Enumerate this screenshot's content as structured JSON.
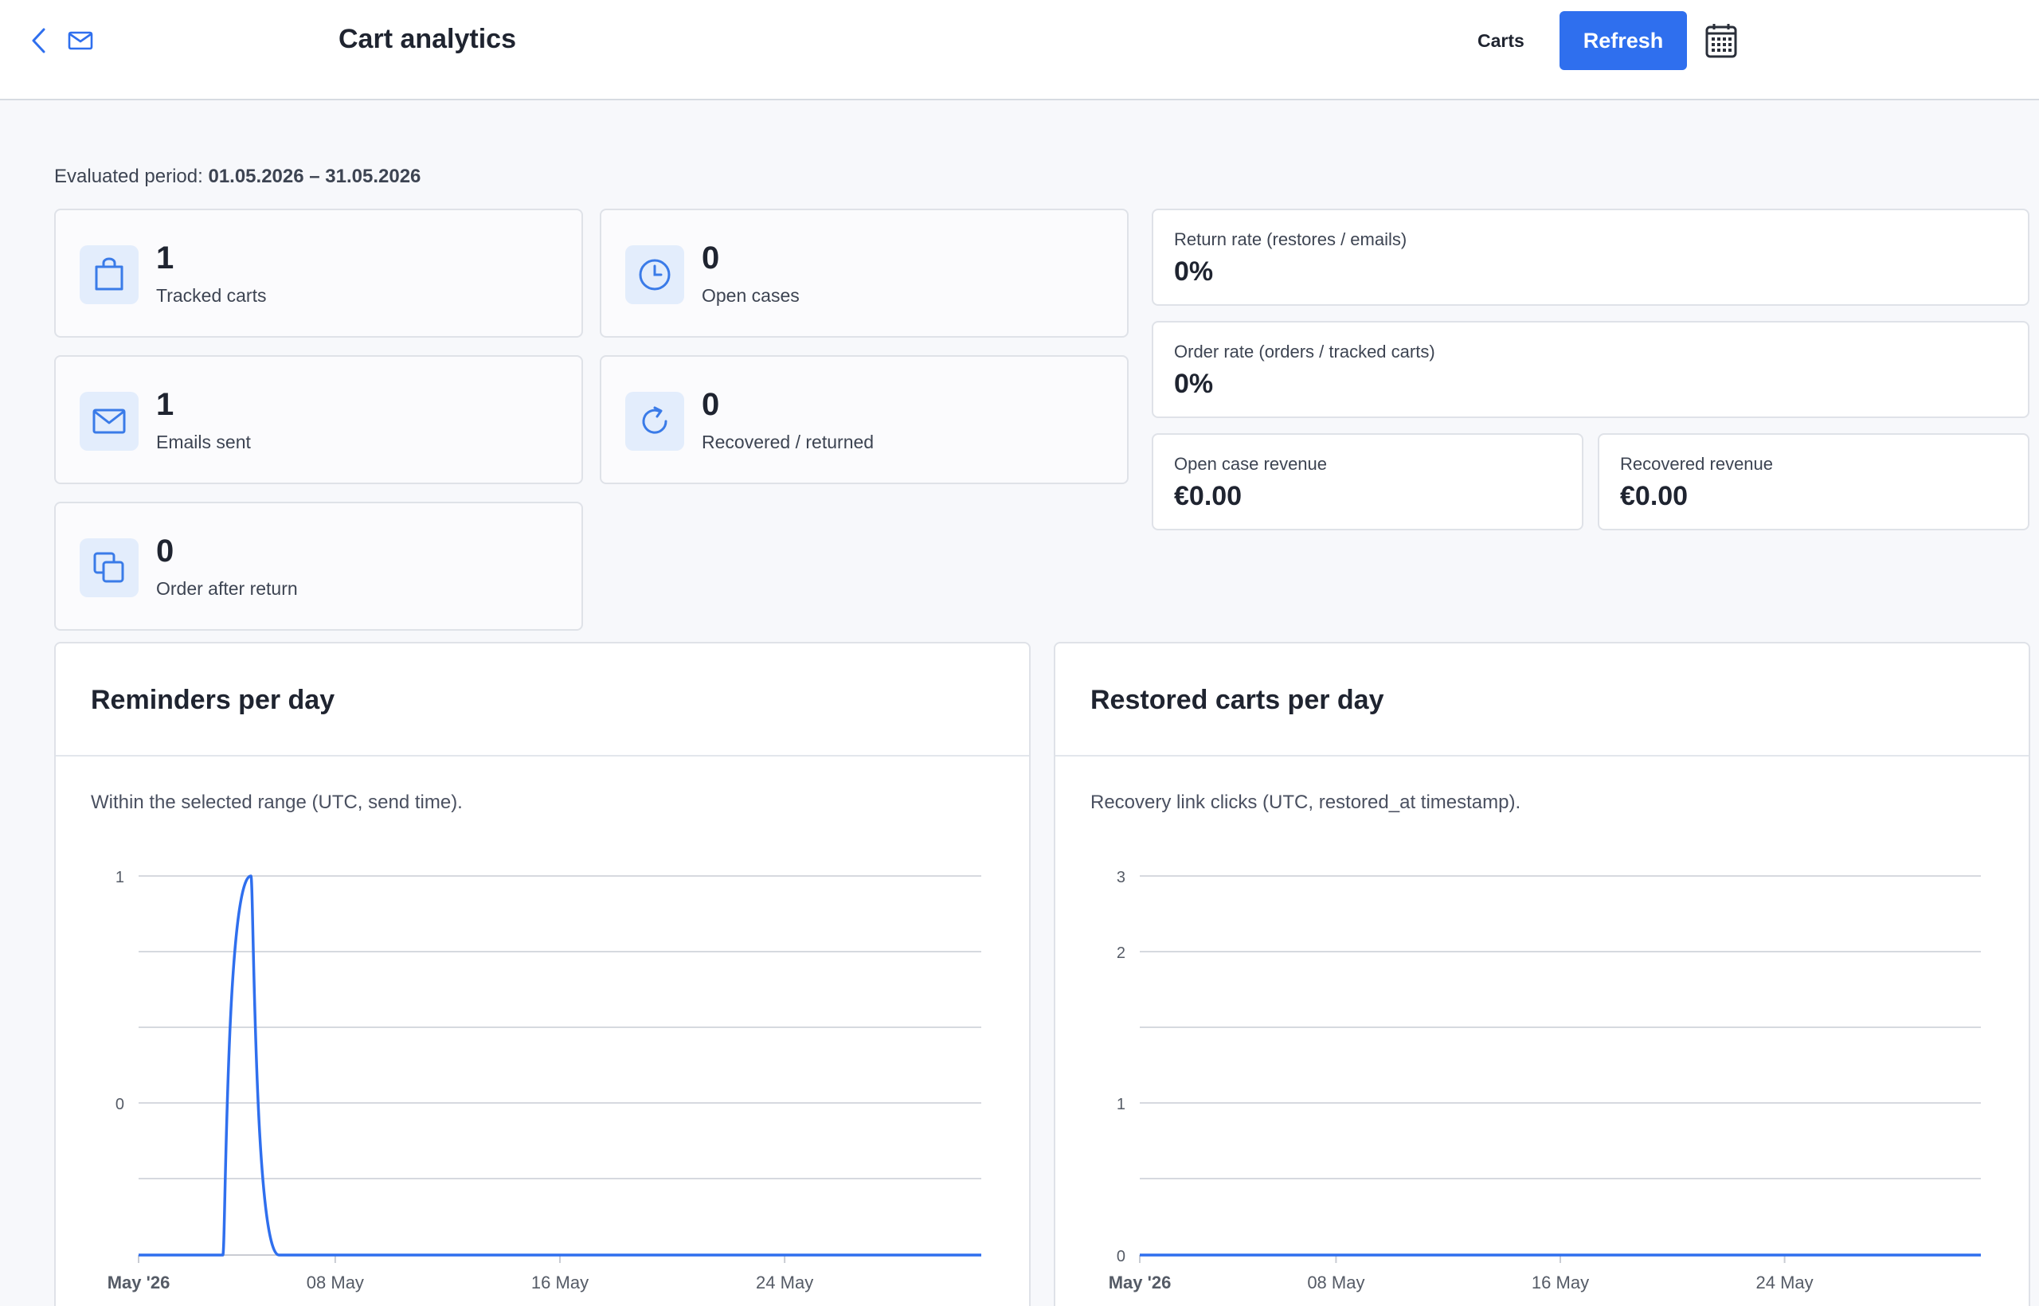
{
  "header": {
    "title": "Cart analytics",
    "nav_link": "Carts",
    "refresh_label": "Refresh"
  },
  "period": {
    "label": "Evaluated period:",
    "value": "01.05.2026 – 31.05.2026"
  },
  "stats": [
    {
      "value": "1",
      "label": "Tracked carts",
      "icon": "shopping-bag-icon"
    },
    {
      "value": "0",
      "label": "Open cases",
      "icon": "clock-icon"
    },
    {
      "value": "1",
      "label": "Emails sent",
      "icon": "mail-icon"
    },
    {
      "value": "0",
      "label": "Recovered / returned",
      "icon": "refresh-icon"
    },
    {
      "value": "0",
      "label": "Order after return",
      "icon": "copy-icon"
    }
  ],
  "metrics": {
    "return_rate": {
      "label": "Return rate (restores / emails)",
      "value": "0%"
    },
    "order_rate": {
      "label": "Order rate (orders / tracked carts)",
      "value": "0%"
    },
    "open_revenue": {
      "label": "Open case revenue",
      "value": "€0.00"
    },
    "recovered_revenue": {
      "label": "Recovered revenue",
      "value": "€0.00"
    }
  },
  "colors": {
    "accent": "#2f6fee",
    "icon_bg": "#e3edfc",
    "line": "#2f6fee"
  },
  "chart_data": [
    {
      "type": "line",
      "title": "Reminders per day",
      "subtitle": "Within the selected range (UTC, send time).",
      "x_tick_labels": [
        "May '26",
        "08 May",
        "16 May",
        "24 May"
      ],
      "y_tick_labels": [
        "1",
        "0"
      ],
      "grid": true,
      "series": [
        {
          "x": [
            "2026-05-01",
            "2026-05-02",
            "2026-05-03",
            "2026-05-04",
            "2026-05-05",
            "2026-05-06",
            "2026-05-07",
            "2026-05-08",
            "2026-05-09",
            "2026-05-10",
            "2026-05-11",
            "2026-05-12",
            "2026-05-13",
            "2026-05-14",
            "2026-05-15",
            "2026-05-16",
            "2026-05-17",
            "2026-05-18",
            "2026-05-19",
            "2026-05-20",
            "2026-05-21",
            "2026-05-22",
            "2026-05-23",
            "2026-05-24",
            "2026-05-25",
            "2026-05-26",
            "2026-05-27",
            "2026-05-28",
            "2026-05-29",
            "2026-05-30",
            "2026-05-31"
          ],
          "values": [
            0,
            0,
            0,
            0,
            1,
            0,
            0,
            0,
            0,
            0,
            0,
            0,
            0,
            0,
            0,
            0,
            0,
            0,
            0,
            0,
            0,
            0,
            0,
            0,
            0,
            0,
            0,
            0,
            0,
            0,
            0
          ]
        }
      ]
    },
    {
      "type": "line",
      "title": "Restored carts per day",
      "subtitle": "Recovery link clicks (UTC, restored_at timestamp).",
      "x_tick_labels": [
        "May '26",
        "08 May",
        "16 May",
        "24 May"
      ],
      "y_tick_labels": [
        "3",
        "2",
        "1",
        "0"
      ],
      "grid": true,
      "series": [
        {
          "x": [
            "2026-05-01",
            "2026-05-31"
          ],
          "values": [
            0,
            0
          ]
        }
      ]
    }
  ]
}
